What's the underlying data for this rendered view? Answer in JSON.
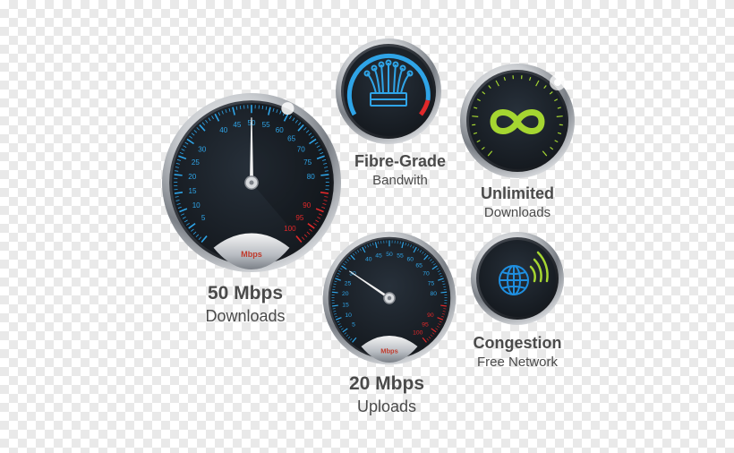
{
  "colors": {
    "caption": "#4a4a4a",
    "tick_blue": "#2fa4e7",
    "tick_red": "#e0282a",
    "infinity_green": "#a5d631",
    "globe_blue": "#1f8fe0",
    "signal_green": "#a5d631",
    "face": "#1c2128"
  },
  "features": [
    {
      "icon": "speedometer-icon",
      "title": "50 Mbps",
      "subtitle": "Downloads",
      "unit": "Mbps",
      "needle_value": 50
    },
    {
      "icon": "fibre-optic-icon",
      "title": "Fibre-Grade",
      "subtitle": "Bandwith"
    },
    {
      "icon": "infinity-icon",
      "title": "Unlimited",
      "subtitle": "Downloads"
    },
    {
      "icon": "speedometer-icon",
      "title": "20 Mbps",
      "subtitle": "Uploads",
      "unit": "Mbps",
      "needle_value": 30
    },
    {
      "icon": "globe-signal-icon",
      "title": "Congestion",
      "subtitle": "Free Network"
    }
  ],
  "gauge_scale": {
    "labels": [
      "5",
      "10",
      "15",
      "20",
      "25",
      "30",
      "40",
      "45",
      "50",
      "55",
      "60",
      "65",
      "70",
      "75",
      "80",
      "90",
      "95",
      "100"
    ],
    "red_labels": [
      "90",
      "95",
      "100"
    ]
  }
}
